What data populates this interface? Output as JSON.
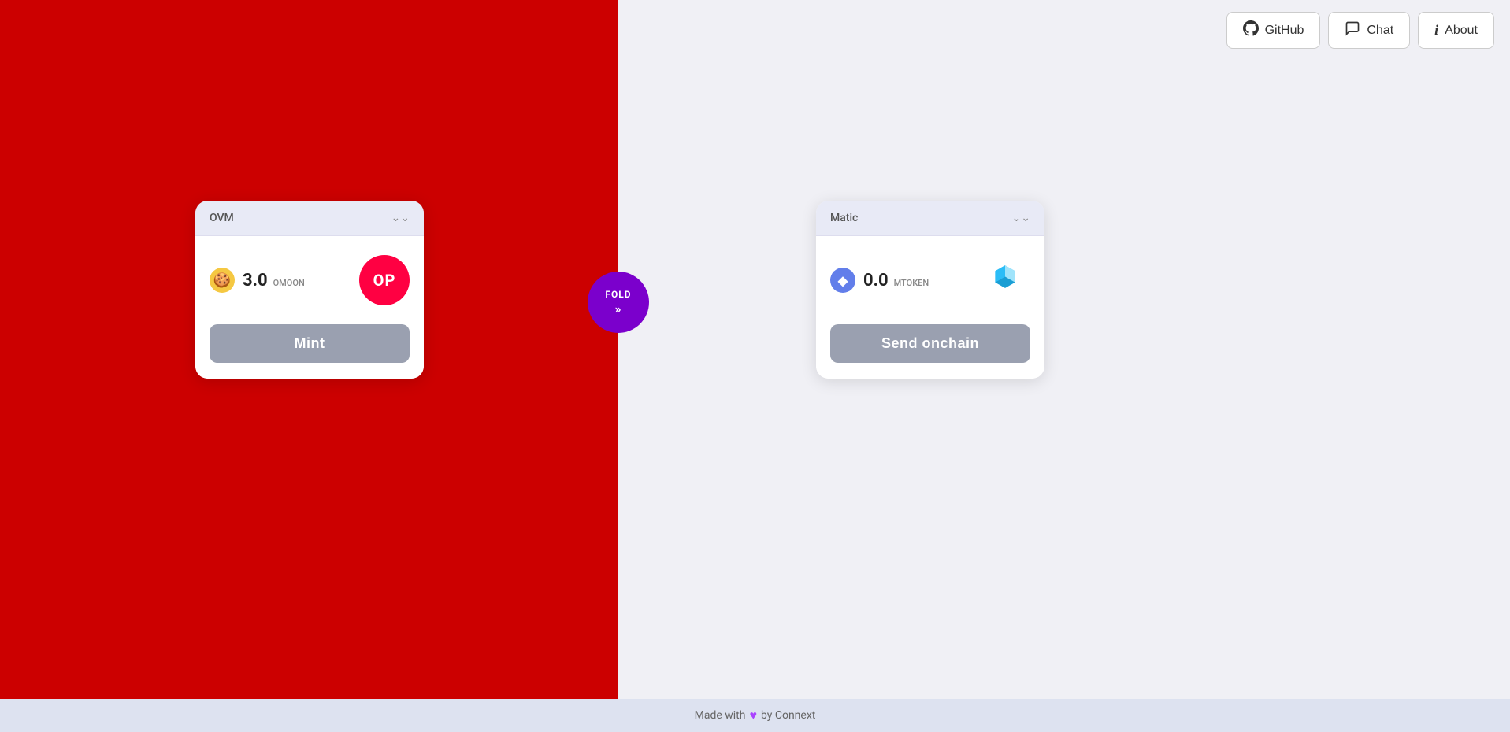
{
  "header": {
    "github_label": "GitHub",
    "chat_label": "Chat",
    "about_label": "About"
  },
  "left_card": {
    "network": "OVM",
    "token_amount": "3.0",
    "token_symbol": "OMOON",
    "chain_symbol": "OP",
    "mint_label": "Mint"
  },
  "fold_button": {
    "label": "FOLD"
  },
  "right_card": {
    "network": "Matic",
    "token_amount": "0.0",
    "token_symbol": "MTOKEN",
    "send_label": "Send onchain"
  },
  "footer": {
    "text": "Made with",
    "by": "by Connext",
    "heart": "♥"
  }
}
